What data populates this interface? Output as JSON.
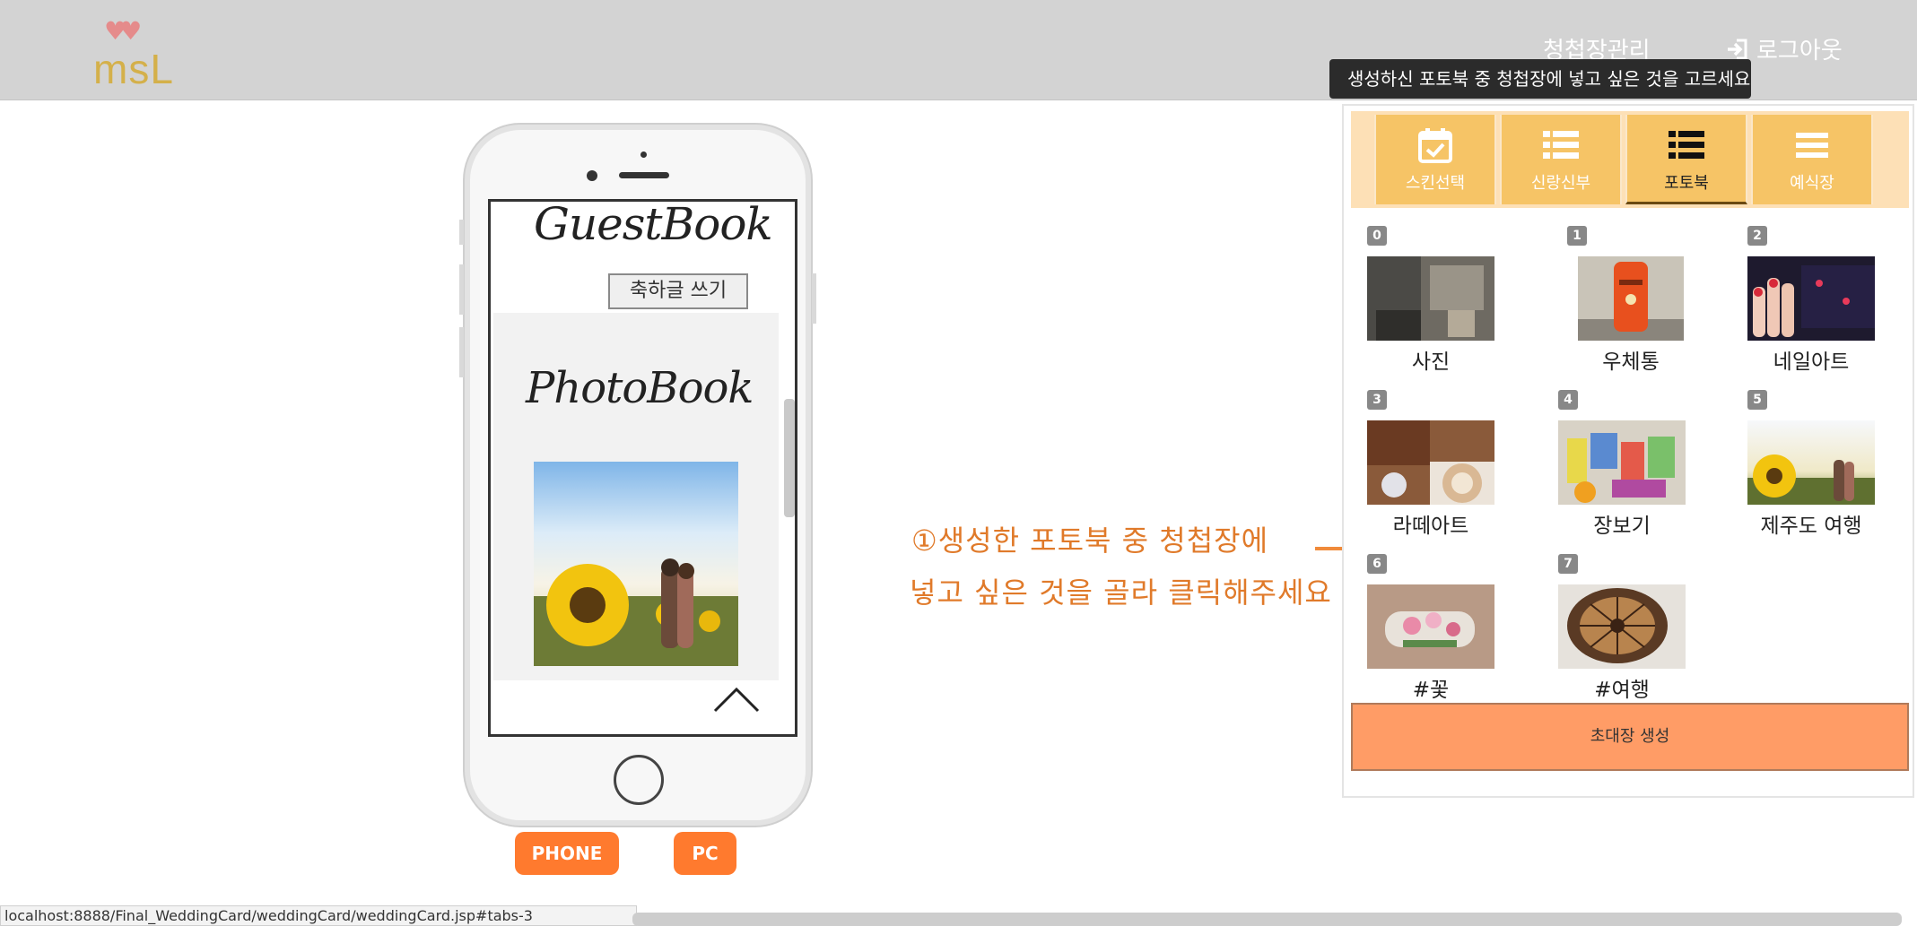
{
  "header": {
    "logo_text": "msL",
    "nav_manage": "청첩장관리",
    "nav_logout": "로그아웃"
  },
  "tooltip": "생성하신 포토북 중 청첩장에 넣고 싶은 것을 고르세요",
  "phone_preview": {
    "guestbook_title": "GuestBook",
    "write_button": "축하글 쓰기",
    "photobook_title": "PhotoBook"
  },
  "view_buttons": {
    "phone": "PHONE",
    "pc": "PC"
  },
  "annotation": {
    "line1": "①생성한 포토북 중 청첩장에",
    "line2": "넣고 싶은 것을 골라 클릭해주세요"
  },
  "tabs": [
    {
      "label": "스킨선택",
      "icon": "calendar-check-icon"
    },
    {
      "label": "신랑신부",
      "icon": "list-icon"
    },
    {
      "label": "포토북",
      "icon": "list-icon",
      "active": true
    },
    {
      "label": "예식장",
      "icon": "menu-icon"
    }
  ],
  "photobooks": [
    {
      "num": "0",
      "label": "사진"
    },
    {
      "num": "1",
      "label": "우체통"
    },
    {
      "num": "2",
      "label": "네일아트"
    },
    {
      "num": "3",
      "label": "라떼아트"
    },
    {
      "num": "4",
      "label": "장보기"
    },
    {
      "num": "5",
      "label": "제주도 여행"
    },
    {
      "num": "6",
      "label": "#꽃"
    },
    {
      "num": "7",
      "label": "#여행"
    }
  ],
  "create_button": "초대장 생성",
  "status_url": "localhost:8888/Final_WeddingCard/weddingCard/weddingCard.jsp#tabs-3",
  "colors": {
    "topbar": "#d3d3d3",
    "accent_orange": "#ff7a2e",
    "tab_yellow": "#f6c466",
    "create_button": "#ff9c66",
    "annotation": "#e07a2a"
  }
}
